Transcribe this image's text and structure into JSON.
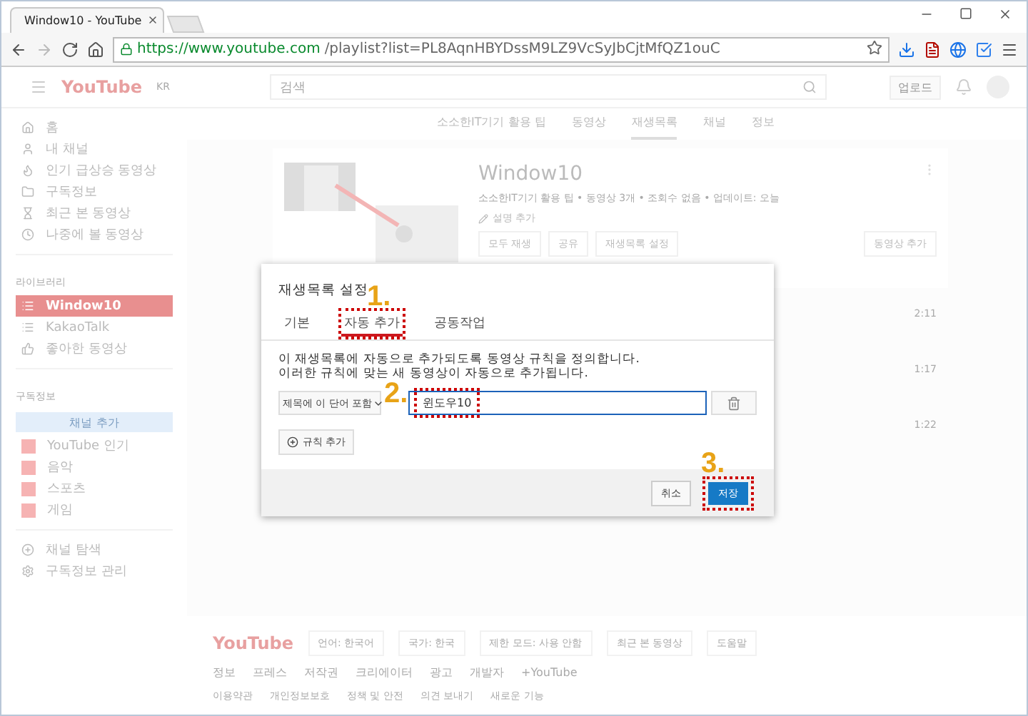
{
  "browser": {
    "tab_title": "Window10 - YouTube",
    "url_host": "https://www.youtube.com",
    "url_path": "/playlist?list=PL8AqnHBYDssM9LZ9VcSyJbCjtMfQZ1ouC"
  },
  "header": {
    "logo": "YouTube",
    "logo_suffix": "KR",
    "search_placeholder": "검색",
    "upload": "업로드"
  },
  "sidebar": {
    "items": [
      {
        "label": "홈",
        "selected": false
      },
      {
        "label": "내 채널",
        "selected": false
      },
      {
        "label": "인기 급상승 동영상",
        "selected": false
      },
      {
        "label": "구독정보",
        "selected": false
      },
      {
        "label": "최근 본 동영상",
        "selected": false
      },
      {
        "label": "나중에 볼 동영상",
        "selected": false
      }
    ],
    "library_heading": "라이브러리",
    "library": [
      {
        "label": "Window10",
        "selected": true
      },
      {
        "label": "KakaoTalk",
        "selected": false
      },
      {
        "label": "좋아한 동영상",
        "selected": false
      }
    ],
    "subs_heading": "구독정보",
    "subs_button": "채널 추가",
    "subs": [
      {
        "label": "YouTube 인기",
        "color": "#f6b3b3"
      },
      {
        "label": "음악",
        "color": "#f6b3b3"
      },
      {
        "label": "스포츠",
        "color": "#f6b3b3"
      },
      {
        "label": "게임",
        "color": "#f6b3b3"
      }
    ],
    "bottom": [
      "채널 탐색",
      "구독정보 관리"
    ]
  },
  "channel_tabs": [
    {
      "label": "소소한IT기기 활용 팁",
      "selected": false
    },
    {
      "label": "동영상",
      "selected": false
    },
    {
      "label": "재생목록",
      "selected": true
    },
    {
      "label": "채널",
      "selected": false
    },
    {
      "label": "정보",
      "selected": false
    }
  ],
  "playlist": {
    "title": "Window10",
    "meta": "소소한IT기기 활용 팁 • 동영상 3개 • 조회수 없음 • 업데이트: 오늘",
    "add_description": "설명 추가",
    "buttons": [
      "모두 재생",
      "공유",
      "재생목록 설정"
    ],
    "add_video": "동영상 추가",
    "durations": [
      "2:11",
      "1:17",
      "1:22"
    ]
  },
  "dialog": {
    "title": "재생목록 설정",
    "tabs": [
      {
        "label": "기본",
        "selected": false,
        "highlighted": false
      },
      {
        "label": "자동 추가",
        "selected": true,
        "highlighted": true
      },
      {
        "label": "공동작업",
        "selected": false,
        "highlighted": false
      }
    ],
    "description": [
      "이 재생목록에 자동으로 추가되도록 동영상 규칙을 정의합니다.",
      "이러한 규칙에 맞는 새 동영상이 자동으로 추가됩니다."
    ],
    "rule_type": "제목에 이 단어 포함",
    "rule_value": "윈도우10",
    "rule_value_highlighted": true,
    "add_rule": "규칙 추가",
    "cancel": "취소",
    "save": "저장",
    "save_highlighted": true
  },
  "annotations": [
    "1.",
    "2.",
    "3."
  ],
  "footer": {
    "logo": "YouTube",
    "controls": [
      "언어: 한국어",
      "국가: 한국",
      "제한 모드: 사용 안함",
      "최근 본 동영상",
      "도움말"
    ],
    "links": [
      "정보",
      "프레스",
      "저작권",
      "크리에이터",
      "광고",
      "개발자",
      "+YouTube"
    ],
    "links2": [
      "이용약관",
      "개인정보보호",
      "정책 및 안전",
      "의견 보내기",
      "새로운 기능"
    ]
  }
}
